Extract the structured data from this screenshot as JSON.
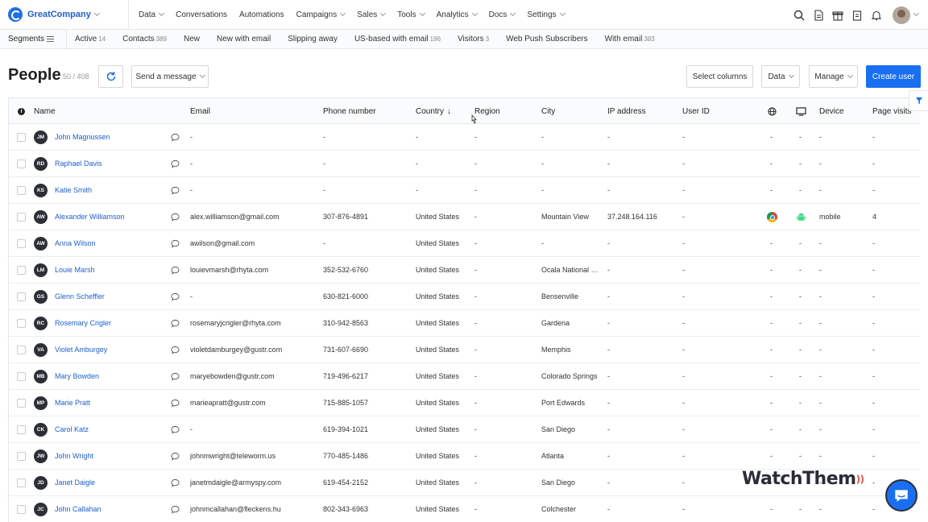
{
  "topnav": {
    "brand": "GreatCompany",
    "menu": [
      {
        "label": "Data",
        "caret": true
      },
      {
        "label": "Conversations",
        "caret": false
      },
      {
        "label": "Automations",
        "caret": false
      },
      {
        "label": "Campaigns",
        "caret": true
      },
      {
        "label": "Sales",
        "caret": true
      },
      {
        "label": "Tools",
        "caret": true
      },
      {
        "label": "Analytics",
        "caret": true
      },
      {
        "label": "Docs",
        "caret": true
      },
      {
        "label": "Settings",
        "caret": true
      }
    ],
    "icons": [
      "search-icon",
      "document-icon",
      "gift-icon",
      "clipboard-icon",
      "bell-icon"
    ]
  },
  "segments": {
    "label": "Segments",
    "items": [
      {
        "label": "Active",
        "count": "14"
      },
      {
        "label": "Contacts",
        "count": "389"
      },
      {
        "label": "New",
        "count": ""
      },
      {
        "label": "New with email",
        "count": ""
      },
      {
        "label": "Slipping away",
        "count": ""
      },
      {
        "label": "US-based with email",
        "count": "196"
      },
      {
        "label": "Visitors",
        "count": "3"
      },
      {
        "label": "Web Push Subscribers",
        "count": ""
      },
      {
        "label": "With email",
        "count": "383"
      }
    ]
  },
  "page": {
    "title": "People",
    "count": "50 / 408",
    "send_message": "Send a message",
    "select_columns": "Select columns",
    "data_btn": "Data",
    "manage_btn": "Manage",
    "create_user": "Create user"
  },
  "table": {
    "headers": {
      "name": "Name",
      "email": "Email",
      "phone": "Phone number",
      "country": "Country",
      "region": "Region",
      "city": "City",
      "ip": "IP address",
      "userid": "User ID",
      "device": "Device",
      "visits": "Page visits"
    },
    "rows": [
      {
        "initials": "JM",
        "name": "John Magnussen",
        "email": "-",
        "phone": "-",
        "country": "-",
        "region": "-",
        "city": "-",
        "ip": "-",
        "userid": "-",
        "browser": "-",
        "os": "-",
        "device": "-",
        "visits": "-"
      },
      {
        "initials": "RD",
        "name": "Raphael Davis",
        "email": "-",
        "phone": "-",
        "country": "-",
        "region": "-",
        "city": "-",
        "ip": "-",
        "userid": "-",
        "browser": "-",
        "os": "-",
        "device": "-",
        "visits": "-"
      },
      {
        "initials": "KS",
        "name": "Katie Smith",
        "email": "-",
        "phone": "-",
        "country": "-",
        "region": "-",
        "city": "-",
        "ip": "-",
        "userid": "-",
        "browser": "-",
        "os": "-",
        "device": "-",
        "visits": "-"
      },
      {
        "initials": "AW",
        "name": "Alexander Williamson",
        "email": "alex.williamson@gmail.com",
        "phone": "307-876-4891",
        "country": "United States",
        "region": "-",
        "city": "Mountain View",
        "ip": "37.248.164.116",
        "userid": "-",
        "browser": "chrome-icon",
        "os": "android-icon",
        "device": "mobile",
        "visits": "4"
      },
      {
        "initials": "AW",
        "name": "Anna Wilson",
        "email": "awilson@gmail.com",
        "phone": "-",
        "country": "United States",
        "region": "-",
        "city": "-",
        "ip": "-",
        "userid": "-",
        "browser": "-",
        "os": "-",
        "device": "-",
        "visits": "-"
      },
      {
        "initials": "LM",
        "name": "Louie Marsh",
        "email": "louievmarsh@rhyta.com",
        "phone": "352-532-6760",
        "country": "United States",
        "region": "-",
        "city": "Ocala National Forest",
        "ip": "-",
        "userid": "-",
        "browser": "-",
        "os": "-",
        "device": "-",
        "visits": "-"
      },
      {
        "initials": "GS",
        "name": "Glenn Scheffler",
        "email": "-",
        "phone": "630-821-6000",
        "country": "United States",
        "region": "-",
        "city": "Bensenville",
        "ip": "-",
        "userid": "-",
        "browser": "-",
        "os": "-",
        "device": "-",
        "visits": "-"
      },
      {
        "initials": "RC",
        "name": "Rosemary Crigler",
        "email": "rosemaryjcrigler@rhyta.com",
        "phone": "310-942-8563",
        "country": "United States",
        "region": "-",
        "city": "Gardena",
        "ip": "-",
        "userid": "-",
        "browser": "-",
        "os": "-",
        "device": "-",
        "visits": "-"
      },
      {
        "initials": "VA",
        "name": "Violet Amburgey",
        "email": "violetdamburgey@gustr.com",
        "phone": "731-607-6690",
        "country": "United States",
        "region": "-",
        "city": "Memphis",
        "ip": "-",
        "userid": "-",
        "browser": "-",
        "os": "-",
        "device": "-",
        "visits": "-"
      },
      {
        "initials": "MB",
        "name": "Mary Bowden",
        "email": "maryebowden@gustr.com",
        "phone": "719-496-6217",
        "country": "United States",
        "region": "-",
        "city": "Colorado Springs",
        "ip": "-",
        "userid": "-",
        "browser": "-",
        "os": "-",
        "device": "-",
        "visits": "-"
      },
      {
        "initials": "MP",
        "name": "Marie Pratt",
        "email": "marieapratt@gustr.com",
        "phone": "715-885-1057",
        "country": "United States",
        "region": "-",
        "city": "Port Edwards",
        "ip": "-",
        "userid": "-",
        "browser": "-",
        "os": "-",
        "device": "-",
        "visits": "-"
      },
      {
        "initials": "CK",
        "name": "Carol Katz",
        "email": "-",
        "phone": "619-394-1021",
        "country": "United States",
        "region": "-",
        "city": "San Diego",
        "ip": "-",
        "userid": "-",
        "browser": "-",
        "os": "-",
        "device": "-",
        "visits": "-"
      },
      {
        "initials": "JW",
        "name": "John Wright",
        "email": "johnmwright@teleworm.us",
        "phone": "770-485-1486",
        "country": "United States",
        "region": "-",
        "city": "Atlanta",
        "ip": "-",
        "userid": "-",
        "browser": "-",
        "os": "-",
        "device": "-",
        "visits": "-"
      },
      {
        "initials": "JD",
        "name": "Janet Daigle",
        "email": "janetmdaigle@armyspy.com",
        "phone": "619-454-2152",
        "country": "United States",
        "region": "-",
        "city": "San Diego",
        "ip": "-",
        "userid": "-",
        "browser": "-",
        "os": "-",
        "device": "-",
        "visits": "-"
      },
      {
        "initials": "JC",
        "name": "John Callahan",
        "email": "johnmcallahan@fleckens.hu",
        "phone": "802-343-6963",
        "country": "United States",
        "region": "-",
        "city": "Colchester",
        "ip": "-",
        "userid": "-",
        "browser": "-",
        "os": "-",
        "device": "-",
        "visits": "-"
      }
    ]
  },
  "watermark": "WatchThem",
  "colors": {
    "accent": "#1a6ff0",
    "link": "#1f5fcf",
    "avatar": "#2c2f36"
  }
}
